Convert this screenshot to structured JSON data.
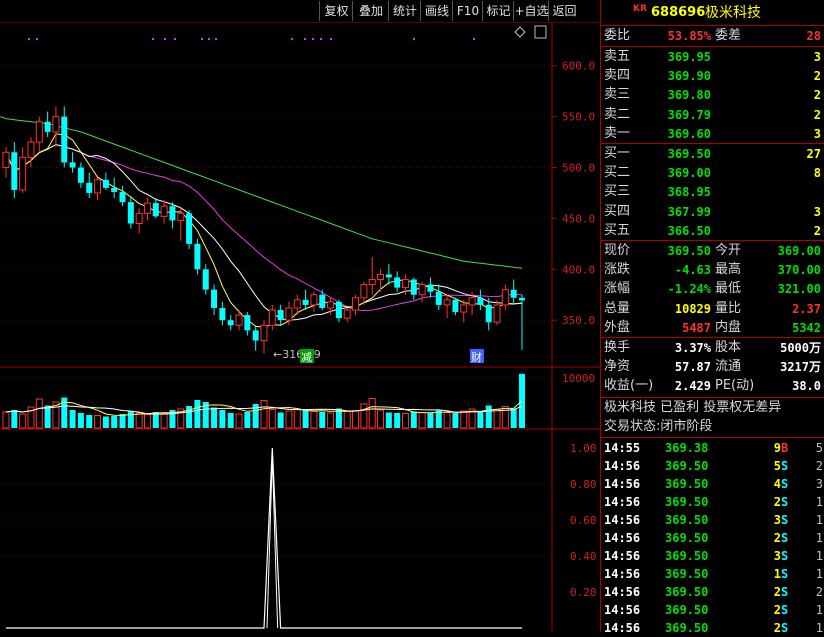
{
  "toolbar": {
    "buttons": [
      "复权",
      "叠加",
      "统计",
      "画线",
      "F10",
      "标记",
      "+自选",
      "返回"
    ]
  },
  "chart_data": {
    "type": "candlestick",
    "price_axis": {
      "ticks": [
        600.0,
        550.0,
        500.0,
        450.0,
        400.0,
        350.0
      ],
      "ylim": [
        305,
        640
      ]
    },
    "volume_axis": {
      "ticks": [
        10000
      ],
      "ylim": [
        0,
        12000
      ]
    },
    "indicator_axis": {
      "ticks": [
        1.0,
        0.8,
        0.6,
        0.4,
        0.2
      ],
      "ylim": [
        0,
        1.1
      ]
    },
    "low_annotation": "←316.89",
    "markers": [
      "减",
      "财"
    ],
    "candles": [
      [
        500,
        520,
        490,
        515
      ],
      [
        515,
        525,
        470,
        478
      ],
      [
        478,
        520,
        475,
        510
      ],
      [
        510,
        530,
        500,
        525
      ],
      [
        525,
        550,
        515,
        545
      ],
      [
        545,
        555,
        530,
        535
      ],
      [
        535,
        560,
        520,
        550
      ],
      [
        550,
        560,
        500,
        505
      ],
      [
        505,
        515,
        495,
        500
      ],
      [
        500,
        505,
        480,
        485
      ],
      [
        485,
        495,
        470,
        475
      ],
      [
        475,
        490,
        468,
        488
      ],
      [
        488,
        495,
        478,
        480
      ],
      [
        480,
        490,
        470,
        476
      ],
      [
        476,
        482,
        462,
        466
      ],
      [
        466,
        472,
        440,
        445
      ],
      [
        445,
        460,
        435,
        455
      ],
      [
        455,
        470,
        448,
        465
      ],
      [
        465,
        470,
        450,
        452
      ],
      [
        452,
        468,
        445,
        462
      ],
      [
        462,
        466,
        440,
        448
      ],
      [
        448,
        460,
        428,
        455
      ],
      [
        455,
        458,
        420,
        425
      ],
      [
        425,
        430,
        395,
        400
      ],
      [
        400,
        405,
        375,
        380
      ],
      [
        380,
        385,
        355,
        362
      ],
      [
        362,
        368,
        345,
        350
      ],
      [
        350,
        355,
        340,
        345
      ],
      [
        345,
        360,
        340,
        355
      ],
      [
        355,
        358,
        335,
        340
      ],
      [
        340,
        345,
        320,
        330
      ],
      [
        330,
        350,
        317,
        345
      ],
      [
        345,
        365,
        340,
        360
      ],
      [
        360,
        365,
        345,
        350
      ],
      [
        350,
        368,
        345,
        362
      ],
      [
        362,
        375,
        355,
        370
      ],
      [
        370,
        380,
        360,
        365
      ],
      [
        365,
        378,
        358,
        375
      ],
      [
        375,
        380,
        360,
        362
      ],
      [
        362,
        372,
        355,
        368
      ],
      [
        368,
        370,
        348,
        352
      ],
      [
        352,
        362,
        348,
        360
      ],
      [
        360,
        375,
        355,
        372
      ],
      [
        372,
        388,
        365,
        385
      ],
      [
        385,
        412,
        375,
        390
      ],
      [
        390,
        400,
        378,
        395
      ],
      [
        395,
        405,
        385,
        392
      ],
      [
        392,
        398,
        378,
        382
      ],
      [
        382,
        395,
        375,
        390
      ],
      [
        390,
        392,
        370,
        375
      ],
      [
        375,
        388,
        368,
        385
      ],
      [
        385,
        392,
        372,
        378
      ],
      [
        378,
        385,
        360,
        365
      ],
      [
        365,
        375,
        352,
        370
      ],
      [
        370,
        372,
        355,
        358
      ],
      [
        358,
        370,
        348,
        365
      ],
      [
        365,
        378,
        355,
        372
      ],
      [
        372,
        380,
        360,
        365
      ],
      [
        365,
        372,
        340,
        348
      ],
      [
        348,
        370,
        345,
        365
      ],
      [
        365,
        385,
        360,
        380
      ],
      [
        380,
        390,
        365,
        372
      ],
      [
        372,
        375,
        321,
        369.5
      ]
    ],
    "volume": [
      3200,
      3600,
      2800,
      4200,
      5800,
      4500,
      5200,
      6100,
      3600,
      3000,
      2600,
      2500,
      2300,
      2400,
      2800,
      3400,
      3000,
      2700,
      3200,
      2900,
      3600,
      3800,
      4400,
      5600,
      5200,
      4100,
      3600,
      3000,
      2800,
      3200,
      4800,
      5500,
      3700,
      3100,
      3400,
      3800,
      3500,
      3300,
      3200,
      3000,
      3900,
      3300,
      3500,
      4800,
      5900,
      3600,
      3100,
      3000,
      2900,
      3300,
      3100,
      3000,
      3500,
      3100,
      3000,
      3400,
      3800,
      3300,
      4500,
      3700,
      4300,
      3900,
      10829
    ],
    "indicator": [
      0,
      0,
      0,
      0,
      0,
      0,
      0,
      0,
      0,
      0,
      0,
      0,
      0,
      0,
      0,
      0,
      0,
      0,
      0,
      0,
      0,
      0,
      0,
      0,
      0,
      0,
      0,
      0,
      0,
      0,
      0,
      0,
      1,
      0,
      0,
      0,
      0,
      0,
      0,
      0,
      0,
      0,
      0,
      0,
      0,
      0,
      0,
      0,
      0,
      0,
      0,
      0,
      0,
      0,
      0,
      0,
      0,
      0,
      0,
      0,
      0,
      0,
      0
    ],
    "ma60": [
      548,
      547,
      546,
      545,
      544,
      543,
      541,
      539,
      537,
      535,
      532,
      529,
      526,
      523,
      520,
      517,
      514,
      511,
      508,
      505,
      502,
      499,
      496,
      493,
      490,
      487,
      484,
      481,
      478,
      475,
      472,
      469,
      466,
      463,
      460,
      457,
      454,
      451,
      448,
      445,
      442,
      439,
      436,
      433,
      430,
      428,
      426,
      424,
      422,
      420,
      418,
      416,
      414,
      412,
      410,
      408,
      407,
      406,
      405,
      404,
      403,
      402,
      401
    ]
  },
  "panel": {
    "prefix": "KR",
    "code": "688696",
    "name": "极米科技",
    "weibi_label": "委比",
    "weibi": "53.85%",
    "weicha_label": "委差",
    "weicha": "28",
    "asks": [
      {
        "label": "卖五",
        "price": "369.95",
        "vol": "3"
      },
      {
        "label": "卖四",
        "price": "369.90",
        "vol": "2"
      },
      {
        "label": "卖三",
        "price": "369.80",
        "vol": "2"
      },
      {
        "label": "卖二",
        "price": "369.79",
        "vol": "2"
      },
      {
        "label": "卖一",
        "price": "369.60",
        "vol": "3"
      }
    ],
    "bids": [
      {
        "label": "买一",
        "price": "369.50",
        "vol": "27"
      },
      {
        "label": "买二",
        "price": "369.00",
        "vol": "8"
      },
      {
        "label": "买三",
        "price": "368.95",
        "vol": ""
      },
      {
        "label": "买四",
        "price": "367.99",
        "vol": "3"
      },
      {
        "label": "买五",
        "price": "366.50",
        "vol": "2"
      }
    ],
    "quote": [
      {
        "l1": "现价",
        "v1": "369.50",
        "c1": "green",
        "l2": "今开",
        "v2": "369.00",
        "c2": "green"
      },
      {
        "l1": "涨跌",
        "v1": "-4.63",
        "c1": "green",
        "l2": "最高",
        "v2": "370.00",
        "c2": "green"
      },
      {
        "l1": "涨幅",
        "v1": "-1.24%",
        "c1": "green",
        "l2": "最低",
        "v2": "321.00",
        "c2": "green"
      },
      {
        "l1": "总量",
        "v1": "10829",
        "c1": "yellow",
        "l2": "量比",
        "v2": "2.37",
        "c2": "red"
      },
      {
        "l1": "外盘",
        "v1": "5487",
        "c1": "red",
        "l2": "内盘",
        "v2": "5342",
        "c2": "green"
      }
    ],
    "stats": [
      {
        "l1": "换手",
        "v1": "3.37%",
        "l2": "股本",
        "v2": "5000万"
      },
      {
        "l1": "净资",
        "v1": "57.87",
        "l2": "流通",
        "v2": "3217万"
      },
      {
        "l1": "收益(一)",
        "v1": "2.429",
        "l2": "PE(动)",
        "v2": "38.0"
      }
    ],
    "info1": "极米科技 已盈利 投票权无差异",
    "info2": "交易状态:闭市阶段",
    "ticks": [
      {
        "t": "14:55",
        "p": "369.38",
        "v": "9",
        "s": "B",
        "n": "5"
      },
      {
        "t": "14:56",
        "p": "369.50",
        "v": "5",
        "s": "S",
        "n": "2"
      },
      {
        "t": "14:56",
        "p": "369.50",
        "v": "4",
        "s": "S",
        "n": "3"
      },
      {
        "t": "14:56",
        "p": "369.50",
        "v": "2",
        "s": "S",
        "n": "1"
      },
      {
        "t": "14:56",
        "p": "369.50",
        "v": "3",
        "s": "S",
        "n": "1"
      },
      {
        "t": "14:56",
        "p": "369.50",
        "v": "2",
        "s": "S",
        "n": "1"
      },
      {
        "t": "14:56",
        "p": "369.50",
        "v": "3",
        "s": "S",
        "n": "1"
      },
      {
        "t": "14:56",
        "p": "369.50",
        "v": "1",
        "s": "S",
        "n": "1"
      },
      {
        "t": "14:56",
        "p": "369.50",
        "v": "2",
        "s": "S",
        "n": "2"
      },
      {
        "t": "14:56",
        "p": "369.50",
        "v": "2",
        "s": "S",
        "n": "1"
      },
      {
        "t": "14:56",
        "p": "369.50",
        "v": "2",
        "s": "S",
        "n": "1"
      }
    ]
  }
}
